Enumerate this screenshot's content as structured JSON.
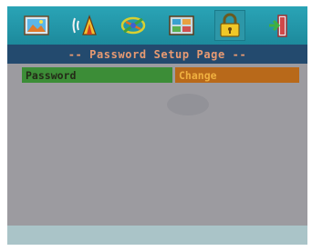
{
  "title": "-- Password Setup Page --",
  "icons": [
    {
      "name": "general-setup-icon"
    },
    {
      "name": "audio-setup-icon"
    },
    {
      "name": "video-setup-icon"
    },
    {
      "name": "preference-setup-icon"
    },
    {
      "name": "password-lock-icon",
      "selected": true
    },
    {
      "name": "exit-setup-icon"
    }
  ],
  "settings": [
    {
      "label": "Password",
      "value": "Change"
    }
  ],
  "colors": {
    "icon_bar": "#1d8a9c",
    "title_bar": "#234a6e",
    "title_text": "#e89a72",
    "screen_bg": "#9c9ba0",
    "selected_label_bg": "#3c8d37",
    "selected_value_bg": "#b8691a",
    "value_text": "#f0b040",
    "bottom_bar": "#aac4c8"
  }
}
